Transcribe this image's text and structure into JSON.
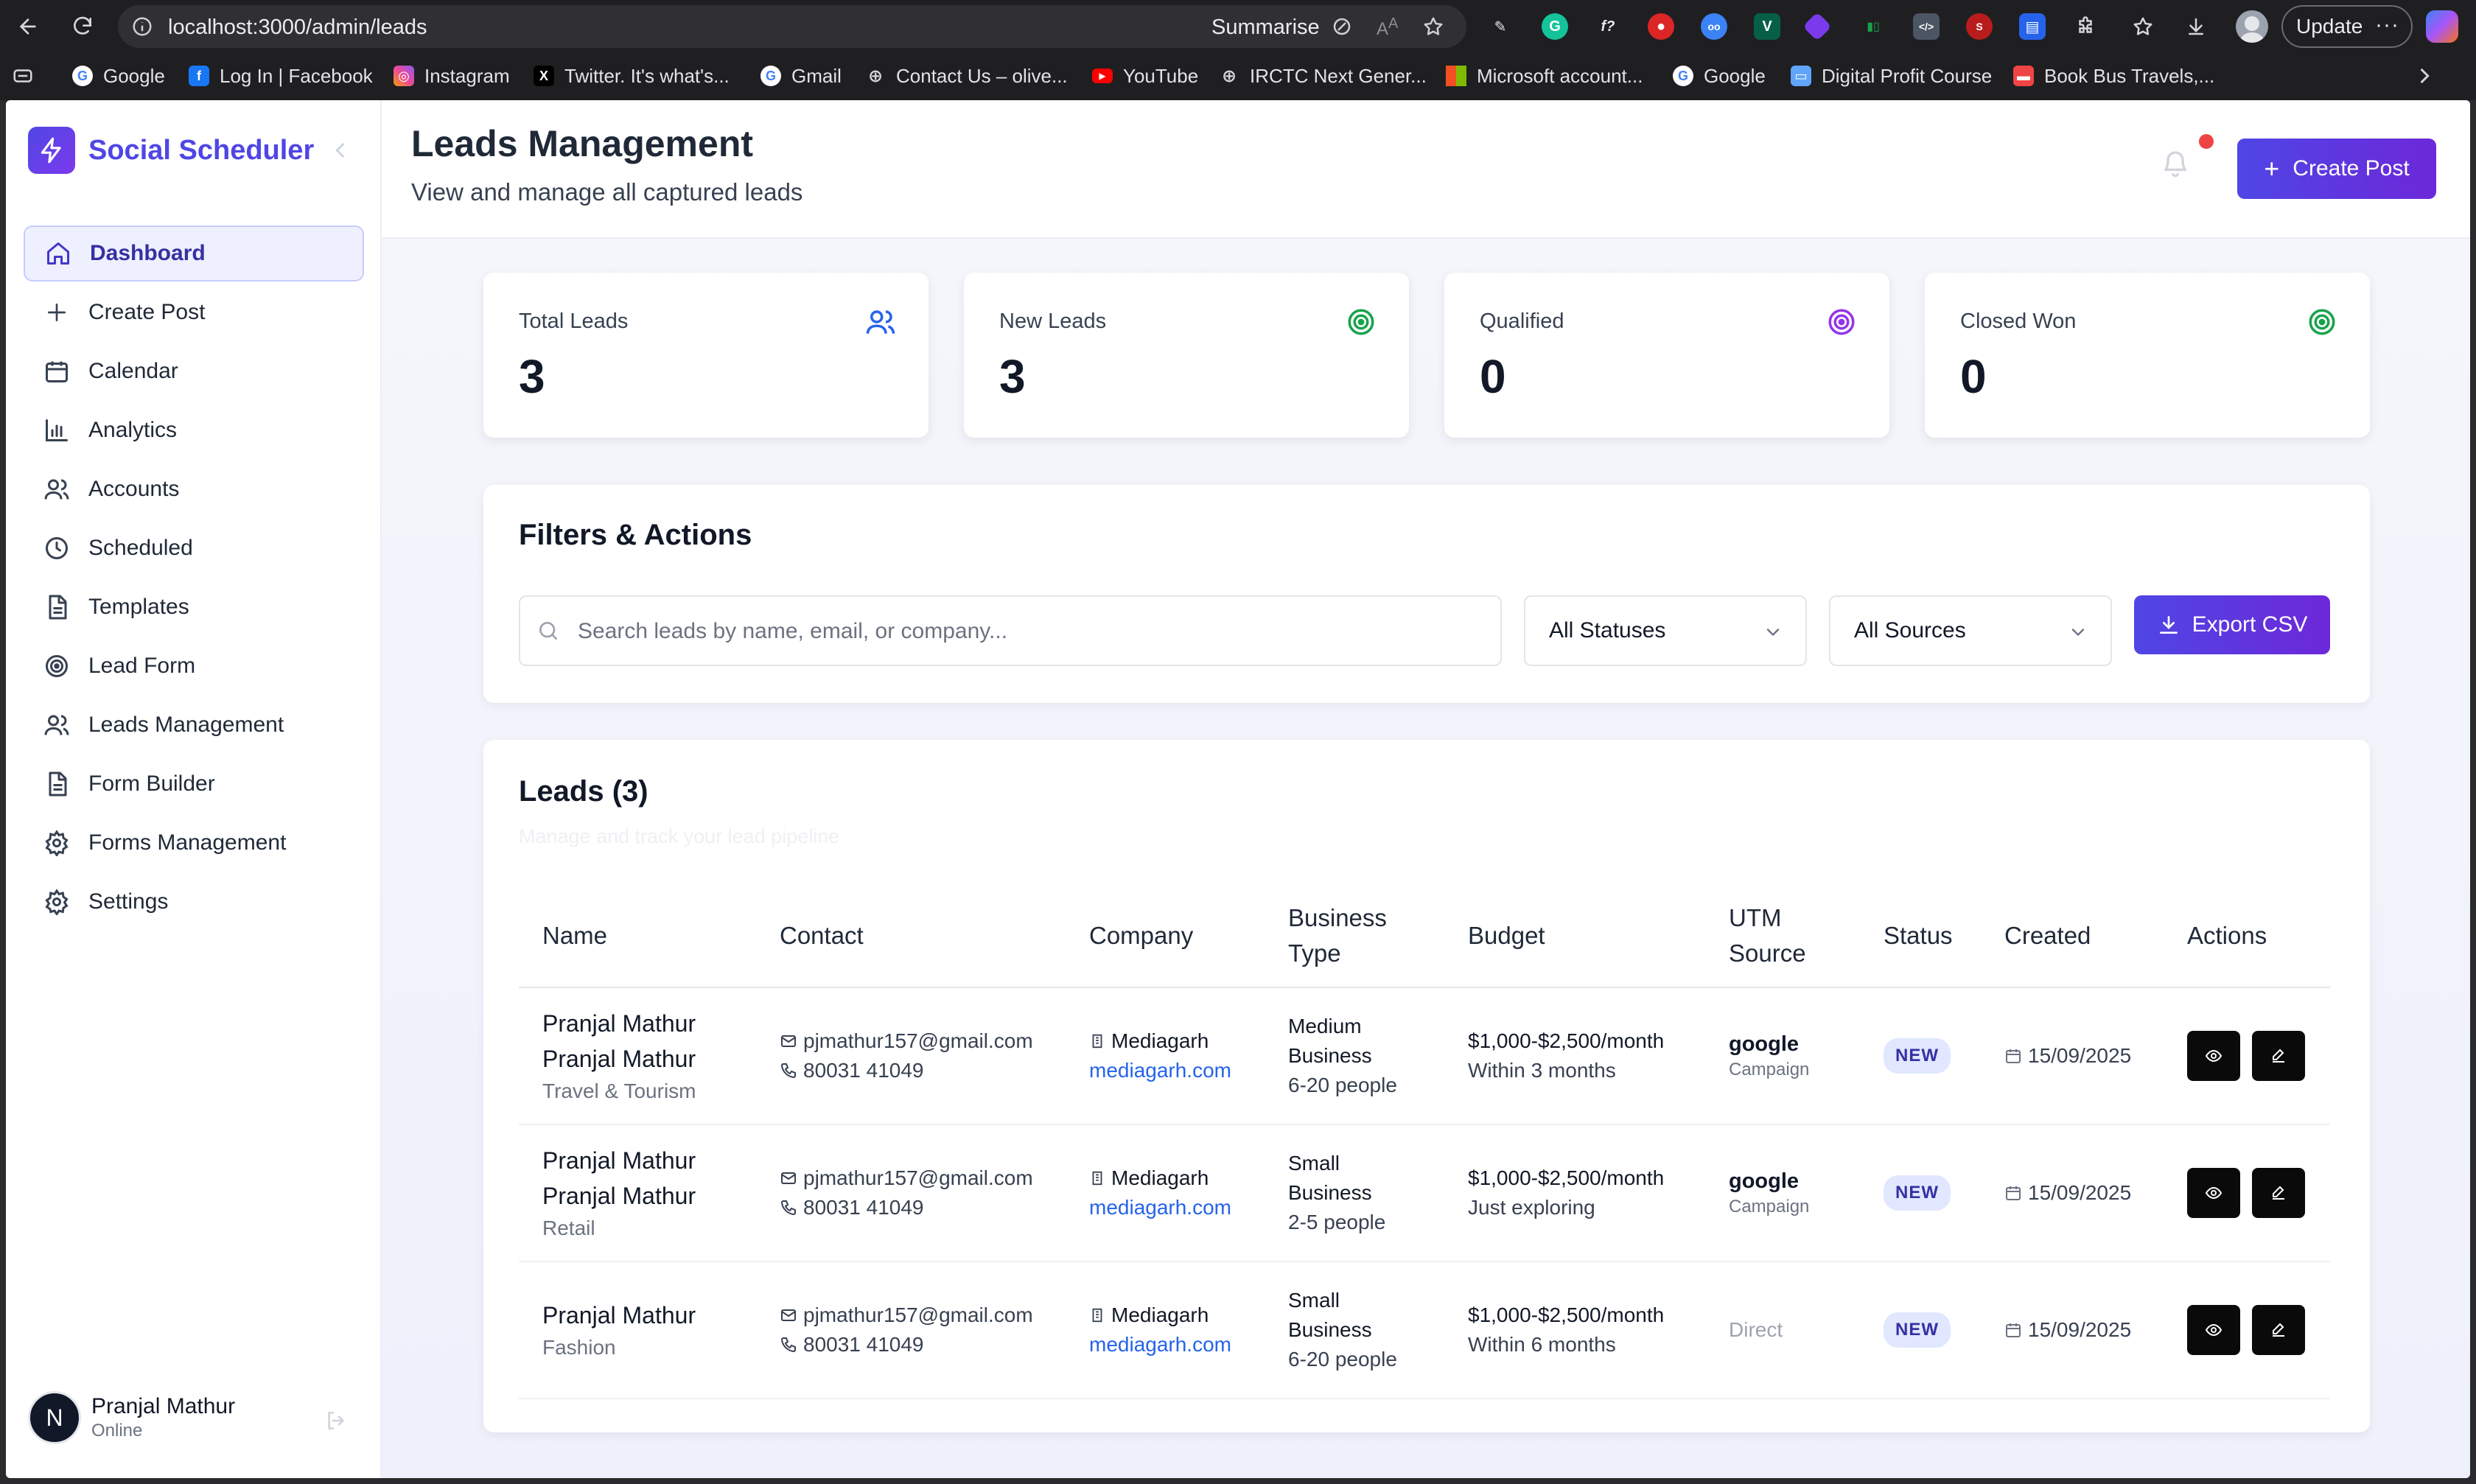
{
  "browser": {
    "url": "localhost:3000/admin/leads",
    "summarise": "Summarise",
    "update": "Update",
    "bookmarks": [
      "Google",
      "Log In | Facebook",
      "Instagram",
      "Twitter. It's what's...",
      "Gmail",
      "Contact Us – olive...",
      "YouTube",
      "IRCTC Next Gener...",
      "Microsoft account...",
      "Google",
      "Digital Profit Course",
      "Book Bus Travels,..."
    ]
  },
  "sidebar": {
    "brand": "Social Scheduler",
    "items": [
      {
        "label": "Dashboard",
        "icon": "home-icon"
      },
      {
        "label": "Create Post",
        "icon": "plus-icon"
      },
      {
        "label": "Calendar",
        "icon": "calendar-icon"
      },
      {
        "label": "Analytics",
        "icon": "bar-chart-icon"
      },
      {
        "label": "Accounts",
        "icon": "users-icon"
      },
      {
        "label": "Scheduled",
        "icon": "clock-icon"
      },
      {
        "label": "Templates",
        "icon": "file-icon"
      },
      {
        "label": "Lead Form",
        "icon": "target-icon"
      },
      {
        "label": "Leads Management",
        "icon": "users-icon"
      },
      {
        "label": "Form Builder",
        "icon": "file-icon"
      },
      {
        "label": "Forms Management",
        "icon": "gear-icon"
      },
      {
        "label": "Settings",
        "icon": "gear-icon"
      }
    ],
    "user": {
      "initial": "N",
      "name": "Pranjal Mathur",
      "status": "Online"
    }
  },
  "header": {
    "title": "Leads Management",
    "subtitle": "View and manage all captured leads",
    "create_label": "Create Post"
  },
  "stats": [
    {
      "label": "Total Leads",
      "value": "3",
      "icon": "users-icon",
      "color": "#2563eb"
    },
    {
      "label": "New Leads",
      "value": "3",
      "icon": "target-icon",
      "color": "#16a34a"
    },
    {
      "label": "Qualified",
      "value": "0",
      "icon": "target-icon",
      "color": "#9333ea"
    },
    {
      "label": "Closed Won",
      "value": "0",
      "icon": "target-icon",
      "color": "#16a34a"
    }
  ],
  "filters": {
    "title": "Filters & Actions",
    "search_placeholder": "Search leads by name, email, or company...",
    "status_select": "All Statuses",
    "source_select": "All Sources",
    "export_label": "Export CSV"
  },
  "leads": {
    "title": "Leads (3)",
    "subtitle": "Manage and track your lead pipeline",
    "columns": [
      "Name",
      "Contact",
      "Company",
      "Business Type",
      "Budget",
      "UTM Source",
      "Status",
      "Created",
      "Actions"
    ],
    "rows": [
      {
        "name1": "Pranjal Mathur",
        "name2": "Pranjal Mathur",
        "industry": "Travel & Tourism",
        "email": "pjmathur157@gmail.com",
        "phone": "80031 41049",
        "company": "Mediagarh",
        "website": "mediagarh.com",
        "btype1": "Medium",
        "btype2": "Business",
        "btype3": "6-20 people",
        "budget": "$1,000-$2,500/month",
        "timeline": "Within 3 months",
        "source": "google",
        "source_sub": "Campaign",
        "status": "NEW",
        "created": "15/09/2025"
      },
      {
        "name1": "Pranjal Mathur",
        "name2": "Pranjal Mathur",
        "industry": "Retail",
        "email": "pjmathur157@gmail.com",
        "phone": "80031 41049",
        "company": "Mediagarh",
        "website": "mediagarh.com",
        "btype1": "Small",
        "btype2": "Business",
        "btype3": "2-5 people",
        "budget": "$1,000-$2,500/month",
        "timeline": "Just exploring",
        "source": "google",
        "source_sub": "Campaign",
        "status": "NEW",
        "created": "15/09/2025"
      },
      {
        "name1": "Pranjal Mathur",
        "industry": "Fashion",
        "email": "pjmathur157@gmail.com",
        "phone": "80031 41049",
        "company": "Mediagarh",
        "website": "mediagarh.com",
        "btype1": "Small",
        "btype2": "Business",
        "btype3": "6-20 people",
        "budget": "$1,000-$2,500/month",
        "timeline": "Within 6 months",
        "source_direct": "Direct",
        "status": "NEW",
        "created": "15/09/2025"
      }
    ]
  },
  "colors": {
    "accent": "#4f46e5",
    "accent2": "#6d28d9",
    "badge_bg": "#e0e7ff",
    "badge_fg": "#3730a3",
    "notify": "#ef4444"
  }
}
